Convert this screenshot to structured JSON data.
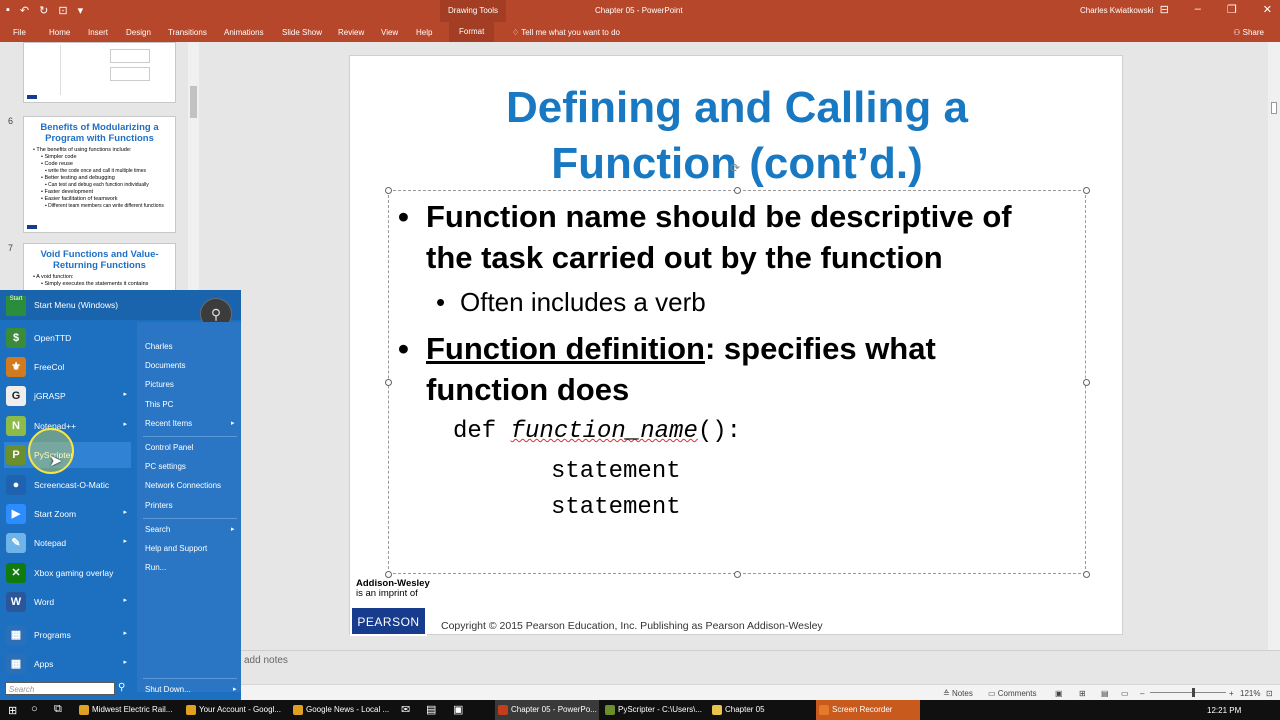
{
  "window": {
    "context_tab": "Drawing Tools",
    "doc_title": "Chapter 05  -  PowerPoint",
    "user": "Charles Kwiatkowski"
  },
  "ribbon": {
    "tabs": [
      "File",
      "Home",
      "Insert",
      "Design",
      "Transitions",
      "Animations",
      "Slide Show",
      "Review",
      "View",
      "Help"
    ],
    "active_tab": "Format",
    "tell_me": "Tell me what you want to do",
    "share": "Share"
  },
  "thumbnails": [
    {
      "number": "6",
      "title": "Benefits of Modularizing a Program with Functions",
      "bullets": [
        {
          "level": 1,
          "text": "The benefits of using functions include:"
        },
        {
          "level": 2,
          "text": "Simpler code"
        },
        {
          "level": 2,
          "text": "Code reuse"
        },
        {
          "level": 3,
          "text": "write the code once and call it multiple times"
        },
        {
          "level": 2,
          "text": "Better testing and debugging"
        },
        {
          "level": 3,
          "text": "Can test and debug each function individually"
        },
        {
          "level": 2,
          "text": "Faster development"
        },
        {
          "level": 2,
          "text": "Easier facilitation of teamwork"
        },
        {
          "level": 3,
          "text": "Different team members can write different functions"
        }
      ]
    },
    {
      "number": "7",
      "title": "Void Functions and Value-Returning Functions",
      "bullets": [
        {
          "level": 1,
          "text": "A void function:"
        },
        {
          "level": 2,
          "text": "Simply executes the statements it contains"
        }
      ]
    }
  ],
  "slide": {
    "title_line1": "Defining and Calling a",
    "title_line2": "Function (cont’d.)",
    "bullet1_line1": "Function name should be descriptive of",
    "bullet1_line2": "the task carried out by the function",
    "sub_bullet": "Often includes a verb",
    "bullet2_term": "Function definition",
    "bullet2_rest": ": specifies what",
    "bullet2_line2": "function does",
    "code_def": "def ",
    "code_name": "function_name",
    "code_tail": "():",
    "code_stmt1": "statement",
    "code_stmt2": "statement",
    "publisher": "Addison-Wesley",
    "imprint": "is an imprint of",
    "pearson": "PEARSON",
    "copyright": "Copyright © 2015 Pearson Education, Inc. Publishing as Pearson Addison-Wesley"
  },
  "notes_placeholder": "add notes",
  "statusbar": {
    "notes": "Notes",
    "comments": "Comments",
    "zoom": "121%",
    "zoom_fraction": 0.55
  },
  "start_menu": {
    "header": "Start Menu (Windows)",
    "logo_text": "Start",
    "apps": [
      {
        "label": "OpenTTD",
        "icon": "openttd-icon",
        "arrow": false,
        "color": "#3b8c3a"
      },
      {
        "label": "FreeCol",
        "icon": "freecol-icon",
        "arrow": false,
        "color": "#d27a1e"
      },
      {
        "label": "jGRASP",
        "icon": "jgrasp-icon",
        "arrow": true,
        "color": "#eeeeee"
      },
      {
        "label": "Notepad++",
        "icon": "notepadpp-icon",
        "arrow": true,
        "color": "#8dbb4a"
      },
      {
        "label": "PyScripter",
        "icon": "pyscripter-icon",
        "arrow": false,
        "color": "#6a8f2c"
      },
      {
        "label": "Screencast-O-Matic",
        "icon": "screencast-icon",
        "arrow": false,
        "color": "#1f62b0"
      },
      {
        "label": "Start Zoom",
        "icon": "zoom-icon",
        "arrow": true,
        "color": "#2d8cff"
      },
      {
        "label": "Notepad",
        "icon": "notepad-icon",
        "arrow": true,
        "color": "#6fb4e8"
      },
      {
        "label": "Xbox gaming overlay",
        "icon": "xbox-icon",
        "arrow": false,
        "color": "#107c10"
      },
      {
        "label": "Word",
        "icon": "word-icon",
        "arrow": true,
        "color": "#2b579a"
      },
      {
        "label": "Programs",
        "icon": "programs-icon",
        "arrow": true,
        "color": "#2a6fb8"
      },
      {
        "label": "Apps",
        "icon": "apps-icon",
        "arrow": true,
        "color": "#2a6fb8"
      }
    ],
    "places": [
      {
        "label": "Charles",
        "arrow": false
      },
      {
        "label": "Documents",
        "arrow": false
      },
      {
        "label": "Pictures",
        "arrow": false
      },
      {
        "label": "This PC",
        "arrow": false
      },
      {
        "label": "Recent Items",
        "arrow": true
      },
      {
        "label": "Control Panel",
        "arrow": false
      },
      {
        "label": "PC settings",
        "arrow": false
      },
      {
        "label": "Network Connections",
        "arrow": false
      },
      {
        "label": "Printers",
        "arrow": false
      },
      {
        "label": "Search",
        "arrow": true
      },
      {
        "label": "Help and Support",
        "arrow": false
      },
      {
        "label": "Run...",
        "arrow": false
      }
    ],
    "search_placeholder": "Search",
    "shutdown": "Shut Down..."
  },
  "taskbar": {
    "items": [
      {
        "label": "Midwest Electric Rail...",
        "color": "#e0a020"
      },
      {
        "label": "Your Account - Googl...",
        "color": "#e0a020"
      },
      {
        "label": "Google News - Local ...",
        "color": "#e0a020"
      },
      {
        "label": "Chapter 05 - PowerPo...",
        "color": "#c43e1c"
      },
      {
        "label": "PyScripter - C:\\Users\\...",
        "color": "#6a8f2c"
      },
      {
        "label": "Chapter 05",
        "color": "#e8c24a"
      },
      {
        "label": "Screen Recorder",
        "color": "#e57a2a"
      }
    ],
    "clock": "12:21 PM"
  },
  "colors": {
    "ppt_accent": "#b7472a",
    "title_blue": "#1878c2",
    "start_blue": "#1d6fc0",
    "pearson_blue": "#173c8e"
  }
}
